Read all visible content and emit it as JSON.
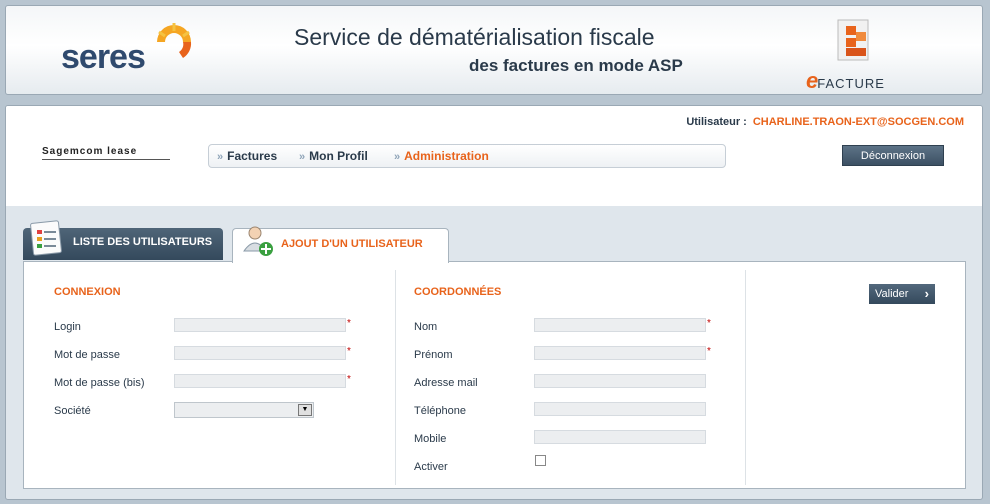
{
  "header": {
    "brand": "seres",
    "title_line1": "Service de dématérialisation fiscale",
    "title_line2": "des factures en mode ASP",
    "efacture_e": "e",
    "efacture_word": "FACTURE"
  },
  "user": {
    "label": "Utilisateur :",
    "value": "CHARLINE.TRAON-EXT@SOCGEN.COM"
  },
  "company_logo_text": "Sagemcom lease",
  "breadcrumb": [
    {
      "label": "Factures"
    },
    {
      "label": "Mon Profil"
    },
    {
      "label": "Administration"
    }
  ],
  "logout_label": "Déconnexion",
  "tabs": [
    {
      "label": "LISTE DES UTILISATEURS"
    },
    {
      "label": "AJOUT D'UN UTILISATEUR"
    }
  ],
  "form": {
    "connexion_title": "CONNEXION",
    "coordonnees_title": "COORDONNÉES",
    "login_label": "Login",
    "password_label": "Mot de passe",
    "password_bis_label": "Mot de passe (bis)",
    "societe_label": "Société",
    "nom_label": "Nom",
    "prenom_label": "Prénom",
    "email_label": "Adresse mail",
    "telephone_label": "Téléphone",
    "mobile_label": "Mobile",
    "activer_label": "Activer",
    "required_mark": "*",
    "valider_label": "Valider"
  },
  "colors": {
    "accent": "#e8631b",
    "navy": "#2a3a4a",
    "button": "#34495c"
  }
}
